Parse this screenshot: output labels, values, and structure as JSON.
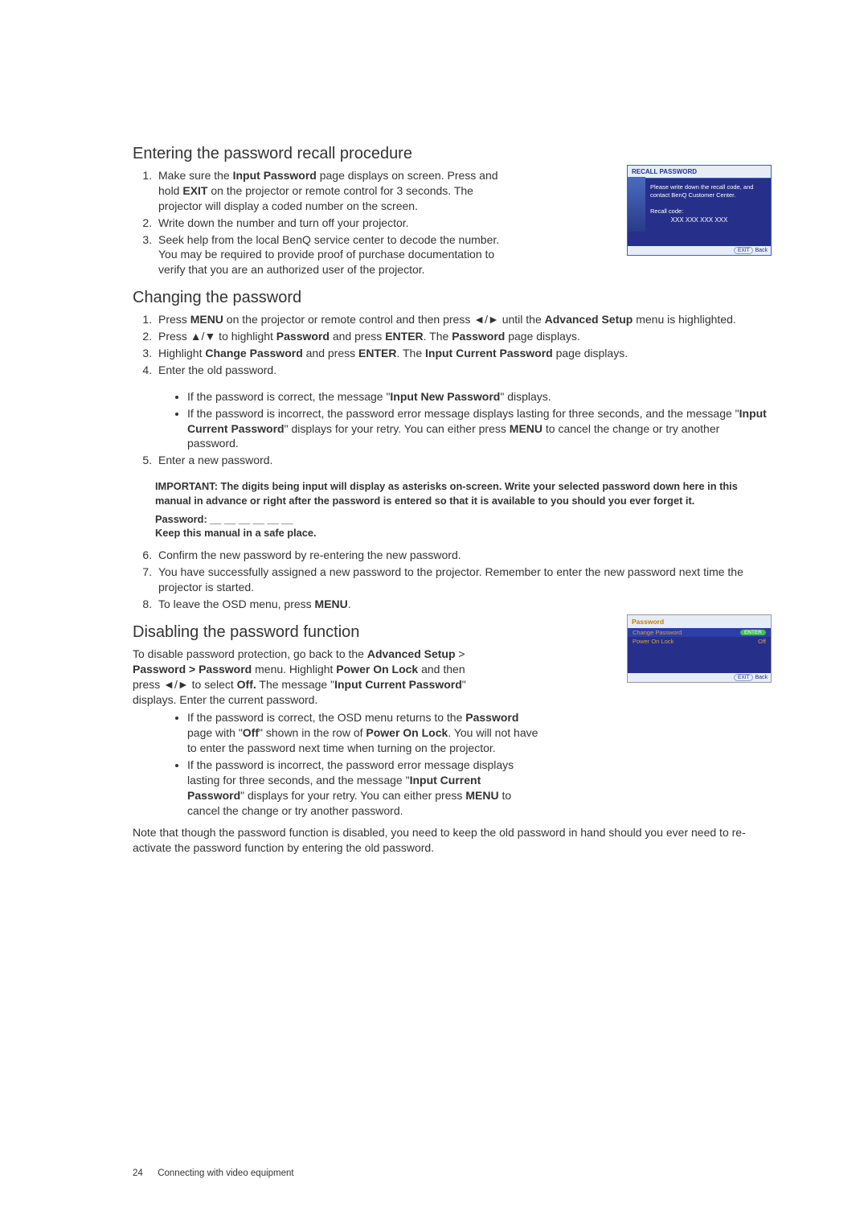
{
  "section1": {
    "heading": "Entering the password recall procedure",
    "item1_a": "Make sure the ",
    "item1_b": "Input Password",
    "item1_c": " page displays on screen. Press and hold ",
    "item1_d": "EXIT",
    "item1_e": " on the projector or remote control for 3 seconds. The projector will display a coded number on the screen.",
    "item2": "Write down the number and turn off your projector.",
    "item3": "Seek help from the local BenQ service center to decode the number. You may be required to provide proof of purchase documentation to verify that you are an authorized user of the projector."
  },
  "section2": {
    "heading": "Changing the password",
    "item1_a": "Press ",
    "item1_b": "MENU",
    "item1_c": " on the projector or remote control and then press ",
    "item1_d": "◄",
    "item1_e": "/",
    "item1_f": "►",
    "item1_g": " until the ",
    "item1_h": "Advanced Setup",
    "item1_i": " menu is highlighted.",
    "item2_a": "Press ",
    "item2_b": "▲",
    "item2_c": "/",
    "item2_d": "▼",
    "item2_e": " to highlight ",
    "item2_f": "Password",
    "item2_g": " and press ",
    "item2_h": "ENTER",
    "item2_i": ". The ",
    "item2_j": "Password",
    "item2_k": " page displays.",
    "item3_a": "Highlight ",
    "item3_b": "Change Password",
    "item3_c": " and press ",
    "item3_d": "ENTER",
    "item3_e": ". The ",
    "item3_f": "Input Current Password",
    "item3_g": " page displays.",
    "item4": "Enter the old password.",
    "b1_a": "If the password is correct, the message \"",
    "b1_b": "Input New Password",
    "b1_c": "\" displays.",
    "b2_a": "If the password is incorrect, the password error message displays lasting for three seconds, and the message \"",
    "b2_b": "Input Current Password",
    "b2_c": "\" displays for your retry. You can either press ",
    "b2_d": "MENU",
    "b2_e": " to cancel the change or try another password.",
    "item5": "Enter a new password.",
    "important": "IMPORTANT: The digits being input will display as asterisks on-screen. Write your selected password down here in this manual in advance or right after the password is entered so that it is available to you should you ever forget it.",
    "pwline": "Password: __ __ __ __ __ __",
    "keep": "Keep this manual in a safe place.",
    "item6": "Confirm the new password by re-entering the new password.",
    "item7": "You have successfully assigned a new password to the projector. Remember to enter the new password next time the projector is started.",
    "item8_a": "To leave the OSD menu, press ",
    "item8_b": "MENU",
    "item8_c": "."
  },
  "section3": {
    "heading": "Disabling the password function",
    "p1_a": "To disable password protection, go back to the ",
    "p1_b": "Advanced Setup",
    "p1_c": " > ",
    "p1_d": "Password > Password",
    "p1_e": " menu. Highlight ",
    "p1_f": "Power On Lock",
    "p1_g": " and then press ",
    "p1_h": "◄",
    "p1_i": "/",
    "p1_j": "►",
    "p1_k": " to select ",
    "p1_l": "Off.",
    "p1_m": " The message \"",
    "p1_n": "Input Current Password",
    "p1_o": "\" displays. Enter the current password.",
    "b1_a": "If the password is correct, the OSD menu returns to the ",
    "b1_b": "Password",
    "b1_c": " page with \"",
    "b1_d": "Off",
    "b1_e": "\" shown in the row of ",
    "b1_f": "Power On Lock",
    "b1_g": ". You will not have to enter the password next time when turning on the projector.",
    "b2_a": "If the password is incorrect, the password error message displays lasting for three seconds, and the message \"",
    "b2_b": "Input Current Password",
    "b2_c": "\" displays for your retry. You can either press ",
    "b2_d": "MENU",
    "b2_e": " to cancel the change or try another password.",
    "note": "Note that though the password function is disabled, you need to keep the old password in hand should you ever need to re-activate the password function by entering the old password."
  },
  "recall_panel": {
    "title": "RECALL PASSWORD",
    "msg": "Please write down the recall code, and contact BenQ Customer Center.",
    "code_label": "Recall code:",
    "code_value": "XXX XXX XXX XXX",
    "exit": "EXIT",
    "back": "Back"
  },
  "pw_panel": {
    "title": "Password",
    "row1": "Change Password",
    "row1_btn": "ENTER",
    "row2": "Power On Lock",
    "row2_val": "Off",
    "exit": "EXIT",
    "back": "Back"
  },
  "footer": {
    "num": "24",
    "label": "Connecting with video equipment"
  }
}
